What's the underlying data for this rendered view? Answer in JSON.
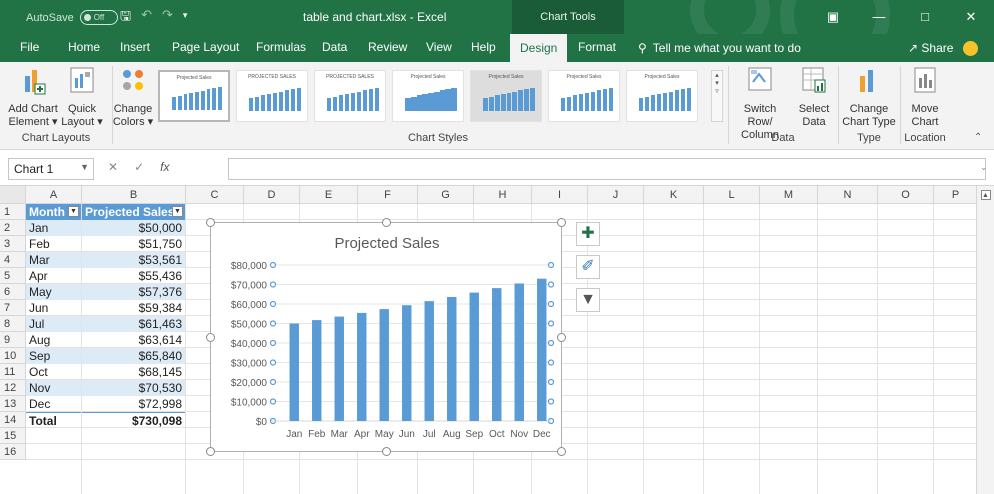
{
  "titlebar": {
    "autosave_label": "AutoSave",
    "autosave_state": "Off",
    "doc_title": "table and chart.xlsx  -  Excel",
    "context_tools": "Chart Tools"
  },
  "tabs": [
    "File",
    "Home",
    "Insert",
    "Page Layout",
    "Formulas",
    "Data",
    "Review",
    "View",
    "Help",
    "Design",
    "Format"
  ],
  "active_tab": "Design",
  "tell_me": "Tell me what you want to do",
  "share_label": "Share",
  "ribbon": {
    "add_chart": "Add Chart Element",
    "add_chart_l1": "Add Chart",
    "add_chart_l2": "Element",
    "quick_l1": "Quick",
    "quick_l2": "Layout",
    "change_colors_l1": "Change",
    "change_colors_l2": "Colors",
    "group_chart_layouts": "Chart Layouts",
    "group_chart_styles": "Chart Styles",
    "switch_l1": "Switch Row/",
    "switch_l2": "Column",
    "select_l1": "Select",
    "select_l2": "Data",
    "group_data": "Data",
    "change_type_l1": "Change",
    "change_type_l2": "Chart Type",
    "group_type": "Type",
    "move_l1": "Move",
    "move_l2": "Chart",
    "group_location": "Location"
  },
  "formula_bar": {
    "name_box": "Chart 1",
    "fx": "fx"
  },
  "columns": [
    "A",
    "B",
    "C",
    "D",
    "E",
    "F",
    "G",
    "H",
    "I",
    "J",
    "K",
    "L",
    "M",
    "N",
    "O",
    "P"
  ],
  "rows": [
    "1",
    "2",
    "3",
    "4",
    "5",
    "6",
    "7",
    "8",
    "9",
    "10",
    "11",
    "12",
    "13",
    "14",
    "15",
    "16"
  ],
  "table": {
    "headers": [
      "Month",
      "Projected Sales"
    ],
    "rows": [
      [
        "Jan",
        "$50,000"
      ],
      [
        "Feb",
        "$51,750"
      ],
      [
        "Mar",
        "$53,561"
      ],
      [
        "Apr",
        "$55,436"
      ],
      [
        "May",
        "$57,376"
      ],
      [
        "Jun",
        "$59,384"
      ],
      [
        "Jul",
        "$61,463"
      ],
      [
        "Aug",
        "$63,614"
      ],
      [
        "Sep",
        "$65,840"
      ],
      [
        "Oct",
        "$68,145"
      ],
      [
        "Nov",
        "$70,530"
      ],
      [
        "Dec",
        "$72,998"
      ]
    ],
    "total": [
      "Total",
      "$730,098"
    ]
  },
  "colors": {
    "excel_green": "#217346",
    "table_header": "#5b9bd5",
    "band": "#ddebf7",
    "bar": "#5b9bd5"
  },
  "chart_data": {
    "type": "bar",
    "title": "Projected Sales",
    "categories": [
      "Jan",
      "Feb",
      "Mar",
      "Apr",
      "May",
      "Jun",
      "Jul",
      "Aug",
      "Sep",
      "Oct",
      "Nov",
      "Dec"
    ],
    "values": [
      50000,
      51750,
      53561,
      55436,
      57376,
      59384,
      61463,
      63614,
      65840,
      68145,
      70530,
      72998
    ],
    "ylim": [
      0,
      80000
    ],
    "yticks": [
      "$0",
      "$10,000",
      "$20,000",
      "$30,000",
      "$40,000",
      "$50,000",
      "$60,000",
      "$70,000",
      "$80,000"
    ],
    "grid": true,
    "xlabel": "",
    "ylabel": ""
  }
}
